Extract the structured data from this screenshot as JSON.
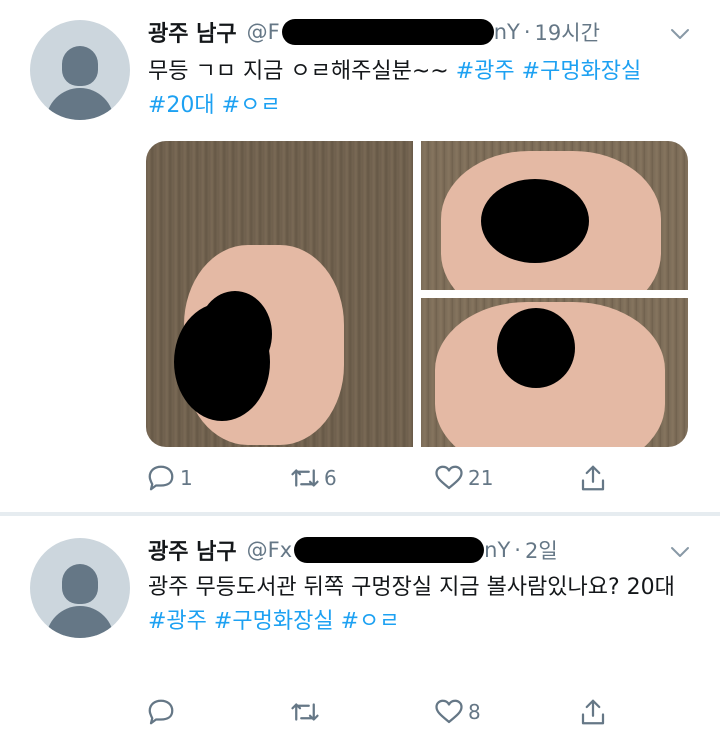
{
  "tweets": [
    {
      "author_name": "광주 남구",
      "handle_prefix": "@F",
      "handle_suffix": "nY",
      "time": "19시간",
      "text_plain": "무등 ㄱㅁ 지금 ㅇㄹ해주실분~~ ",
      "hashtags": [
        "#광주",
        "#구멍화장실",
        "#20대",
        "#ㅇㄹ"
      ],
      "stats": {
        "replies": "1",
        "retweets": "6",
        "likes": "21"
      }
    },
    {
      "author_name": "광주 남구",
      "handle_prefix": "@Fx",
      "handle_suffix": "nY",
      "time": "2일",
      "text_plain": "광주 무등도서관 뒤쪽 구멍장실 지금 볼사람있나요? 20대",
      "hashtags": [
        "#광주",
        "#구멍화장실",
        "#ㅇㄹ"
      ],
      "stats": {
        "replies": "",
        "retweets": "",
        "likes": "8"
      }
    }
  ],
  "dot_separator": "·",
  "icons": [
    "reply-icon",
    "retweet-icon",
    "like-icon",
    "share-icon",
    "chevron-down-icon"
  ],
  "colors": {
    "link": "#1da1f2",
    "secondary": "#657786",
    "redaction": "#000000"
  }
}
